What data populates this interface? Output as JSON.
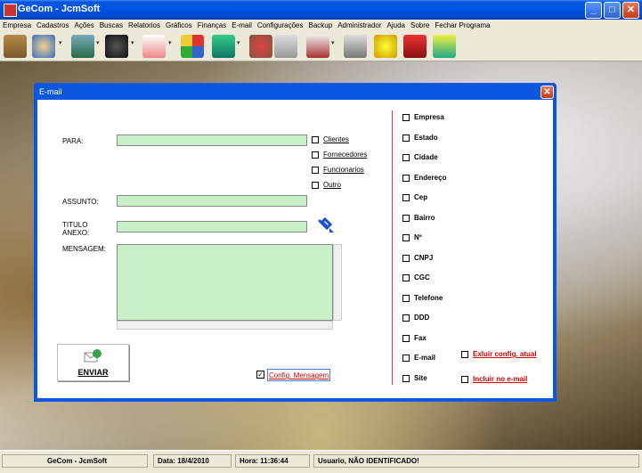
{
  "window": {
    "title": "GeCom - JcmSoft"
  },
  "menu": [
    "Empresa",
    "Cadastros",
    "Ações",
    "Buscas",
    "Relatorios",
    "Gráficos",
    "Finanças",
    "E-mail",
    "Configurações",
    "Backup",
    "Administrador",
    "Ajuda",
    "Sobre",
    "Fechar Programa"
  ],
  "toolbar_icons": [
    "briefcase-icon",
    "handshake-icon",
    "cash-register-icon",
    "binoculars-icon",
    "document-icon",
    "chart-icon",
    "money-icon",
    "envelope-lock-icon",
    "printer-form-icon",
    "profile-card-icon",
    "help-icon",
    "calculator-icon",
    "exit-door-icon"
  ],
  "dialog": {
    "title": "E-mail",
    "para_label": "PARA:",
    "assunto_label": "ASSUNTO:",
    "titulo_label": "TITULO",
    "anexo_label": "ANEXO:",
    "mensagem_label": "MENSAGEM:",
    "para_value": "",
    "assunto_value": "",
    "anexo_value": "",
    "mensagem_value": "",
    "recipient_options": [
      "Clientes",
      "Fornecedores",
      "Funcionarios",
      "Outro"
    ],
    "send_button": "ENVIAR",
    "config_mensagem": {
      "label": "Config. Mensagem",
      "checked": true
    },
    "fields": [
      "Empresa",
      "Estado",
      "Cidade",
      "Endereço",
      "Cep",
      "Bairro",
      "Nº",
      "CNPJ",
      "CGC",
      "Telefone",
      "DDD",
      "Fax",
      "E-mail",
      "Site"
    ],
    "exclude_link": "Exluir config. atual",
    "include_link": "Incluir no e-mail"
  },
  "status": {
    "app": "GeCom - JcmSoft",
    "date": "Data: 18/4/2010",
    "time": "Hora: 11:36:44",
    "user": "Usuario, NÃO IDENTIFICADO!"
  }
}
